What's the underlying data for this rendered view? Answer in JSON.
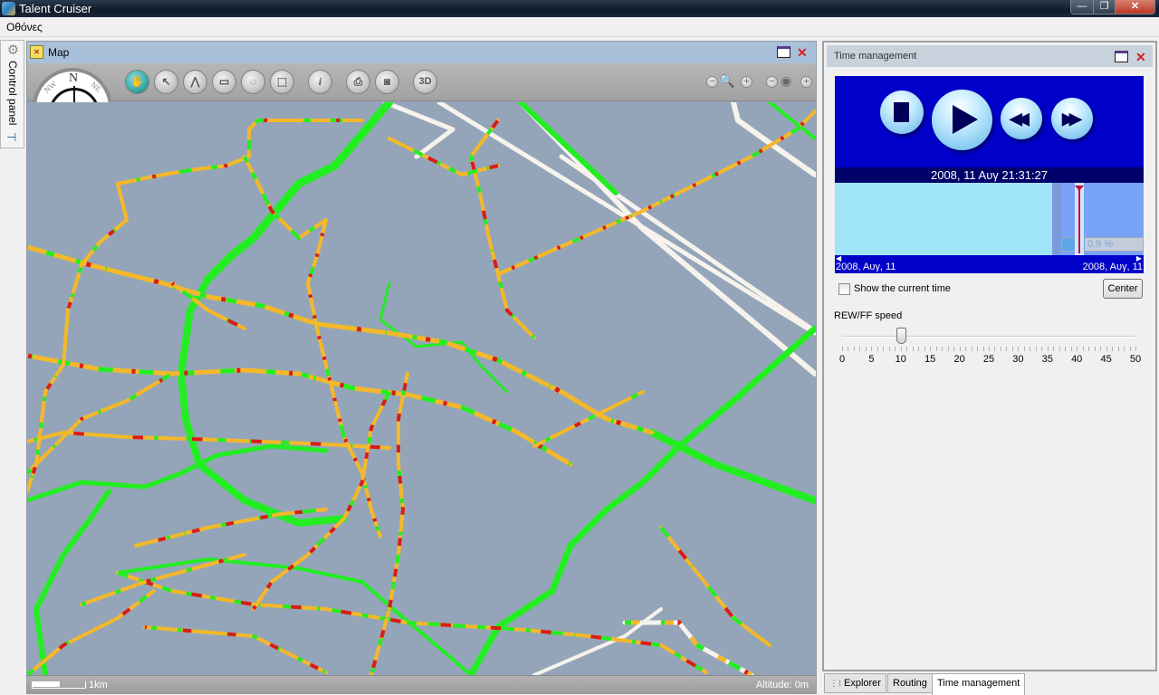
{
  "app": {
    "title": "Talent Cruiser",
    "window_controls": {
      "minimize": "—",
      "restore": "❐",
      "close": "✕"
    }
  },
  "menu": {
    "items": [
      "Οθόνες"
    ]
  },
  "control_panel": {
    "label": "Control panel"
  },
  "map_window": {
    "title": "Map",
    "compass": {
      "n": "N",
      "nw": "NW",
      "ne": "NE"
    },
    "toolbar": {
      "tools": [
        {
          "name": "pan-tool",
          "glyph": "✋",
          "active": true
        },
        {
          "name": "select-tool",
          "glyph": "↖",
          "active": false
        },
        {
          "name": "polyline-tool",
          "glyph": "⋀",
          "active": false
        },
        {
          "name": "measure-tool",
          "glyph": "▭",
          "active": false
        },
        {
          "name": "circle-select-tool",
          "glyph": "◌",
          "active": false
        },
        {
          "name": "rect-select-tool",
          "glyph": "⬚",
          "active": false
        },
        {
          "name": "info-tool",
          "glyph": "i",
          "active": false
        },
        {
          "name": "print-tool",
          "glyph": "⎙",
          "active": false
        },
        {
          "name": "screenshot-tool",
          "glyph": "◙",
          "active": false
        },
        {
          "name": "3d-tool",
          "glyph": "3D",
          "active": false
        }
      ],
      "zoom_out": "−",
      "zoom_in": "+",
      "zoom_glyph": "🔍",
      "view_minus": "−",
      "view_plus": "+",
      "eye_glyph": "◉"
    },
    "scale_label": "1km",
    "altitude": "Altitude: 0m",
    "legend_colors": {
      "free": "#22ee22",
      "moderate": "#f4b82a",
      "congested": "#d81c1c",
      "no_data": "#f6f2ec",
      "background": "#94a5b9"
    }
  },
  "time_management": {
    "title": "Time management",
    "player_buttons": [
      "stop",
      "play",
      "rewind",
      "fast-forward"
    ],
    "current_datetime": "2008, 11 Αυγ 21:31:27",
    "timeline": {
      "start_label": "2008, Αυγ, 11",
      "end_label": "2008, Αυγ, 11",
      "progress_label": "0,9 %",
      "progress": 0.009
    },
    "show_current_time": {
      "label": "Show the current time",
      "checked": false
    },
    "center_button": "Center",
    "speed": {
      "label": "REW/FF speed",
      "min": 0,
      "max": 50,
      "value": 10,
      "tick_labels": [
        "0",
        "5",
        "10",
        "15",
        "20",
        "25",
        "30",
        "35",
        "40",
        "45",
        "50"
      ]
    }
  },
  "bottom_tabs": [
    {
      "label": "Explorer",
      "active": false
    },
    {
      "label": "Routing",
      "active": false
    },
    {
      "label": "Time management",
      "active": true
    }
  ]
}
